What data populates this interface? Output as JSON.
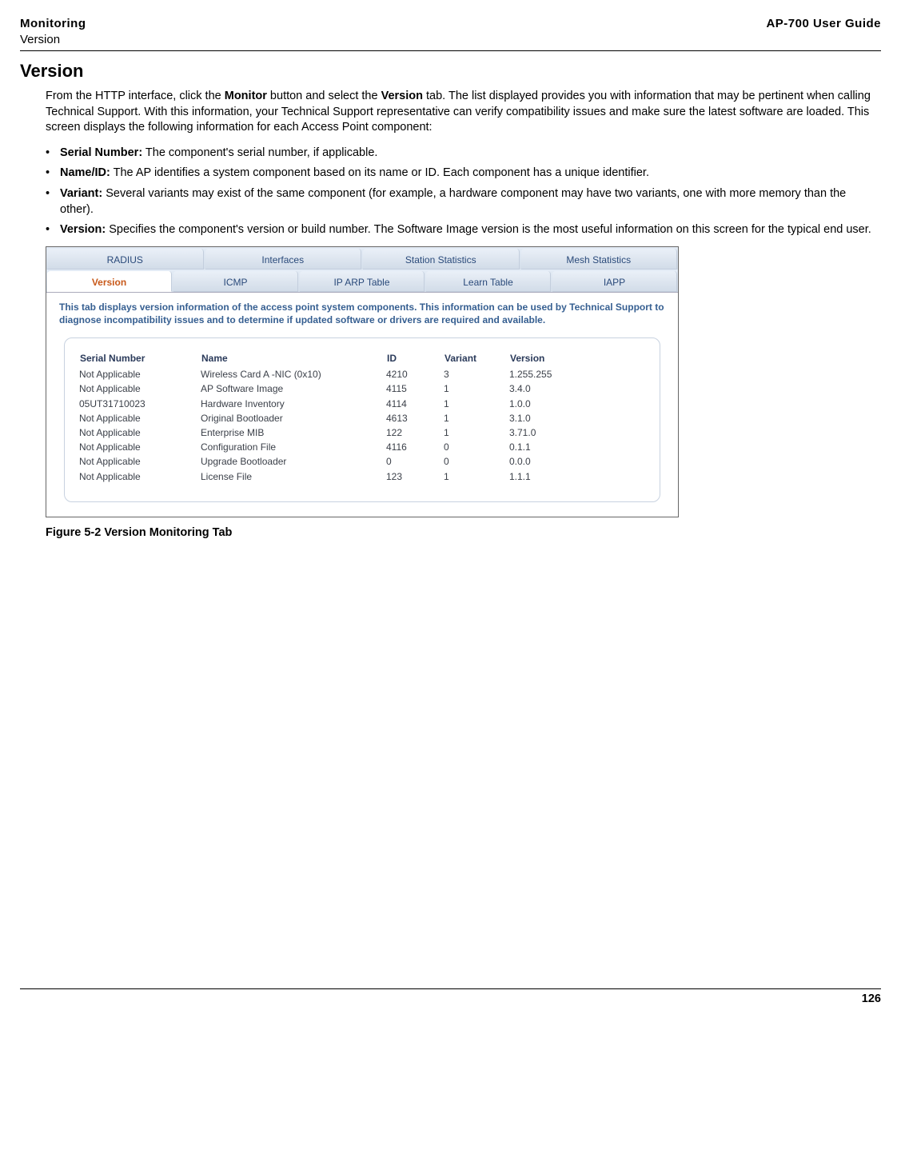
{
  "header": {
    "left_title": "Monitoring",
    "left_subtitle": "Version",
    "right": "AP-700 User Guide"
  },
  "section_heading": "Version",
  "intro": {
    "pre": "From the HTTP interface, click the ",
    "b1": "Monitor",
    "mid": " button and select the ",
    "b2": "Version",
    "post": " tab. The list displayed provides you with information that may be pertinent when calling Technical Support. With this information, your Technical Support representative can verify compatibility issues and make sure the latest software are loaded. This screen displays the following information for each Access Point component:"
  },
  "bullets": [
    {
      "label": "Serial Number:",
      "text": " The component's serial number, if applicable."
    },
    {
      "label": "Name/ID:",
      "text": " The AP identifies a system component based on its name or ID. Each component has a unique identifier."
    },
    {
      "label": "Variant:",
      "text": " Several variants may exist of the same component (for example, a hardware component may have two variants, one with more memory than the other)."
    },
    {
      "label": "Version:",
      "text": " Specifies the component's version or build number. The Software Image version is the most useful information on this screen for the typical end user."
    }
  ],
  "tabs_row1": [
    "RADIUS",
    "Interfaces",
    "Station Statistics",
    "Mesh Statistics"
  ],
  "tabs_row2": [
    "Version",
    "ICMP",
    "IP ARP Table",
    "Learn Table",
    "IAPP"
  ],
  "tab_desc": "This tab displays version information of the access point system components. This information can be used by Technical Support to diagnose incompatibility issues and to determine if updated software or drivers are required and available.",
  "table_headers": [
    "Serial Number",
    "Name",
    "ID",
    "Variant",
    "Version"
  ],
  "table_rows": [
    [
      "Not Applicable",
      "Wireless Card A -NIC (0x10)",
      "4210",
      "3",
      "1.255.255"
    ],
    [
      "Not Applicable",
      "AP Software Image",
      "4115",
      "1",
      "3.4.0"
    ],
    [
      "05UT31710023",
      "Hardware Inventory",
      "4114",
      "1",
      "1.0.0"
    ],
    [
      "Not Applicable",
      "Original Bootloader",
      "4613",
      "1",
      "3.1.0"
    ],
    [
      "Not Applicable",
      "Enterprise MIB",
      "122",
      "1",
      "3.71.0"
    ],
    [
      "Not Applicable",
      "Configuration File",
      "4116",
      "0",
      "0.1.1"
    ],
    [
      "Not Applicable",
      "Upgrade Bootloader",
      "0",
      "0",
      "0.0.0"
    ],
    [
      "Not Applicable",
      "License File",
      "123",
      "1",
      "1.1.1"
    ]
  ],
  "figure_caption": "Figure 5-2 Version Monitoring Tab",
  "page_number": "126"
}
